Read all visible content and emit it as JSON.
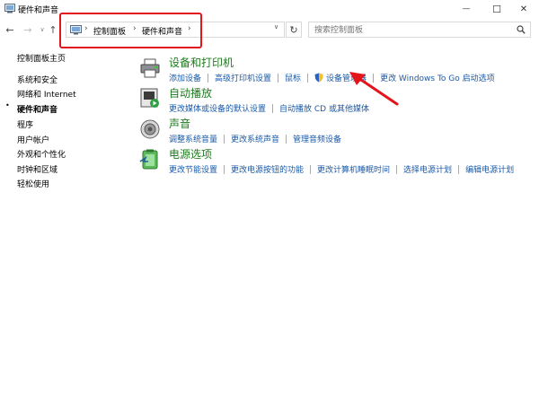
{
  "window": {
    "title": "硬件和声音",
    "minimize_glyph": "—",
    "maximize_glyph": "☐",
    "close_glyph": "✕"
  },
  "nav": {
    "back_glyph": "←",
    "forward_glyph": "→",
    "history_glyph": "∨",
    "up_glyph": "↑",
    "refresh_glyph": "↻"
  },
  "address": {
    "sep_glyph": "›",
    "crumbs": [
      "控制面板",
      "硬件和声音"
    ],
    "dropdown_glyph": "∨"
  },
  "search": {
    "placeholder": "搜索控制面板"
  },
  "sidebar": {
    "bullet": "•",
    "items": [
      {
        "label": "控制面板主页"
      },
      {
        "label": "系统和安全"
      },
      {
        "label": "网络和 Internet"
      },
      {
        "label": "硬件和声音"
      },
      {
        "label": "程序"
      },
      {
        "label": "用户帐户"
      },
      {
        "label": "外观和个性化"
      },
      {
        "label": "时钟和区域"
      },
      {
        "label": "轻松使用"
      }
    ]
  },
  "categories": [
    {
      "title": "设备和打印机",
      "icon": "printer-icon",
      "links": [
        "添加设备",
        "高级打印机设置",
        "鼠标",
        "设备管理器",
        "更改 Windows To Go 启动选项"
      ]
    },
    {
      "title": "自动播放",
      "icon": "autoplay-icon",
      "links": [
        "更改媒体或设备的默认设置",
        "自动播放 CD 或其他媒体"
      ]
    },
    {
      "title": "声音",
      "icon": "speaker-icon",
      "links": [
        "调整系统音量",
        "更改系统声音",
        "管理音频设备"
      ]
    },
    {
      "title": "电源选项",
      "icon": "power-options-icon",
      "links": [
        "更改节能设置",
        "更改电源按钮的功能",
        "更改计算机睡眠时间",
        "选择电源计划",
        "编辑电源计划"
      ]
    }
  ],
  "colors": {
    "category_title": "#1e7b1e",
    "link": "#1a5aa8",
    "annotation_red": "#e4141b"
  }
}
